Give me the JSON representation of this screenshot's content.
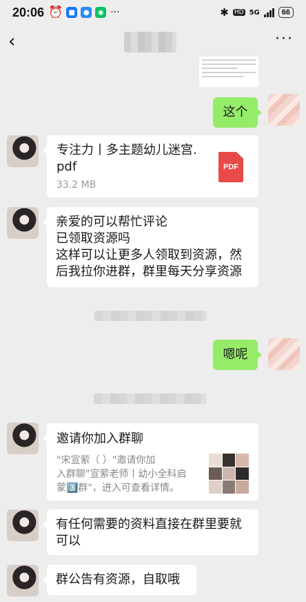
{
  "status_bar": {
    "time": "20:06",
    "network": "5G",
    "battery": "66",
    "hd_label": "HD"
  },
  "nav": {
    "back_icon": "chevron-left-icon",
    "more_icon": "more-dots-icon"
  },
  "messages": [
    {
      "type": "image",
      "from": "me"
    },
    {
      "type": "text",
      "from": "me",
      "text": "这个"
    },
    {
      "type": "file",
      "from": "other",
      "file_name": "专注力丨多主题幼儿迷宫.pdf",
      "file_size": "33.2 MB",
      "file_icon_label": "PDF"
    },
    {
      "type": "text",
      "from": "other",
      "lines": [
        "亲爱的可以帮忙评论",
        "已领取资源吗",
        "这样可以让更多人领取到资源，然",
        "后我拉你进群，群里每天分享资源"
      ]
    },
    {
      "type": "system"
    },
    {
      "type": "text",
      "from": "me",
      "text": "嗯呢"
    },
    {
      "type": "system"
    },
    {
      "type": "invite",
      "from": "other",
      "title": "邀请你加入群聊",
      "desc_lines": [
        "\"宋宣萦（            ）\"邀请你加",
        "入群聊\"宣萦老师丨幼小全科启",
        "蒙3️⃣群\"，进入可查看详情。"
      ]
    },
    {
      "type": "text",
      "from": "other",
      "lines": [
        "有任何需要的资料直接在群里要就",
        "可以"
      ]
    },
    {
      "type": "text",
      "from": "other",
      "text": "群公告有资源，自取哦"
    }
  ],
  "colors": {
    "background": "#ededed",
    "my_bubble": "#95ec69",
    "other_bubble": "#ffffff",
    "pdf_red": "#e84a4a"
  }
}
